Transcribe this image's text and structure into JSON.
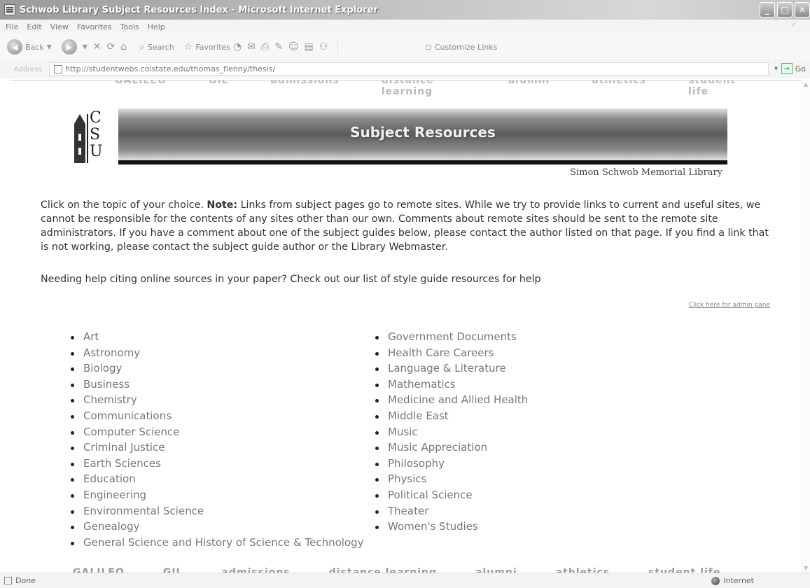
{
  "window": {
    "title": "Schwob Library Subject Resources Index - Microsoft Internet Explorer",
    "minimize_glyph": "_",
    "maximize_glyph": "□",
    "close_glyph": "✕"
  },
  "menu": [
    "File",
    "Edit",
    "View",
    "Favorites",
    "Tools",
    "Help"
  ],
  "toolbar": {
    "back": "Back",
    "search": "Search",
    "favorites": "Favorites",
    "customize_links": "Customize Links"
  },
  "address": {
    "label": "Address",
    "url": "http://studentwebs.colstate.edu/thomas_flenny/thesis/",
    "go": "Go"
  },
  "page": {
    "top_nav": [
      "GALILEO",
      "GIL",
      "admissions",
      "distance learning",
      "alumni",
      "athletics",
      "student life"
    ],
    "logo_letters": [
      "C",
      "S",
      "U"
    ],
    "banner_title": "Subject Resources",
    "library_name": "Simon Schwob Memorial Library",
    "intro_prefix": "Click on the topic of your choice. ",
    "note_label": "Note:",
    "intro_body": " Links from subject pages go to remote sites. While we try to provide links to current and useful sites, we cannot be responsible for the contents of any sites other than our own. Comments about remote sites should be sent to the remote site administrators. If you have a comment about one of the subject guides below, please contact the author listed on that page. If you find a link that is not working, please contact the subject guide author or the Library Webmaster.",
    "citing_text": "Needing help citing online sources in your paper? Check out our list of style guide resources for help",
    "admin_link": "Click here for admin pane",
    "subjects_left": [
      "Art",
      "Astronomy",
      "Biology",
      "Business",
      "Chemistry",
      "Communications",
      "Computer Science",
      "Criminal Justice",
      "Earth Sciences",
      "Education",
      "Engineering",
      "Environmental Science",
      "Genealogy",
      "General Science and History of Science & Technology"
    ],
    "subjects_right": [
      "Government Documents",
      "Health Care Careers",
      "Language & Literature",
      "Mathematics",
      "Medicine and Allied Health",
      "Middle East",
      "Music",
      "Music Appreciation",
      "Philosophy",
      "Physics",
      "Political Science",
      "Theater",
      "Women's Studies"
    ],
    "bottom_nav": [
      "GALILEO",
      "GIL",
      "admissions",
      "distance learning",
      "alumni",
      "athletics",
      "student life"
    ]
  },
  "status": {
    "text": "Done",
    "zone": "Internet"
  }
}
